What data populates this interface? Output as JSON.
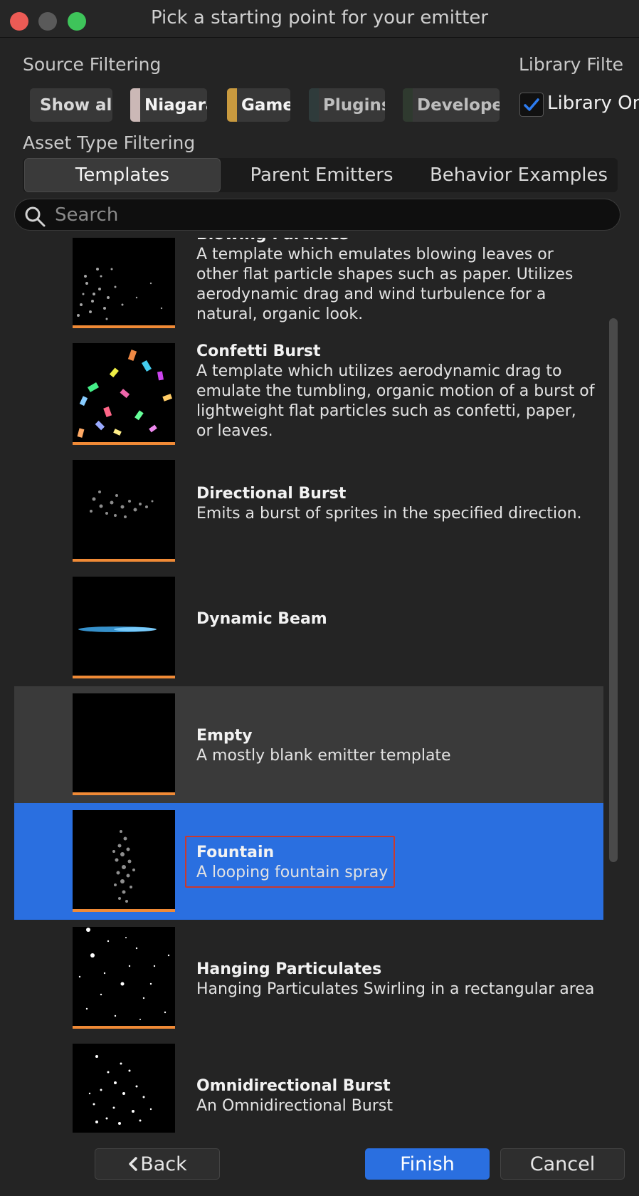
{
  "window": {
    "title": "Pick a starting point for your emitter"
  },
  "source_filtering": {
    "label": "Source Filtering",
    "buttons": [
      {
        "label": "Show all",
        "color": null
      },
      {
        "label": "Niagara",
        "color": "#cbb8b6"
      },
      {
        "label": "Game",
        "color": "#c99a3f"
      },
      {
        "label": "Plugins",
        "color": "#2f3b3b"
      },
      {
        "label": "Developer",
        "color": "#2f3a2f"
      }
    ]
  },
  "library_filtering": {
    "label": "Library Filte",
    "checkbox_label": "Library Onl",
    "checked": true
  },
  "asset_type_filtering": {
    "label": "Asset Type Filtering",
    "tabs": [
      "Templates",
      "Parent Emitters",
      "Behavior Examples"
    ],
    "active_tab": "Templates"
  },
  "search": {
    "placeholder": "Search",
    "value": ""
  },
  "items": [
    {
      "name": "Blowing Particles",
      "desc": "A template which emulates blowing leaves or other flat particle shapes such as paper. Utilizes aerodynamic drag and wind turbulence for a natural, organic look."
    },
    {
      "name": "Confetti Burst",
      "desc": "A template which utilizes aerodynamic drag to emulate the tumbling, organic motion of a burst of lightweight flat particles such as confetti, paper, or leaves."
    },
    {
      "name": "Directional Burst",
      "desc": "Emits a burst of sprites in the specified direction."
    },
    {
      "name": "Dynamic Beam",
      "desc": ""
    },
    {
      "name": "Empty",
      "desc": "A mostly blank emitter template",
      "state": "hover"
    },
    {
      "name": "Fountain",
      "desc": "A looping fountain spray",
      "state": "selected"
    },
    {
      "name": "Hanging Particulates",
      "desc": "Hanging Particulates Swirling in a rectangular area"
    },
    {
      "name": "Omnidirectional Burst",
      "desc": "An Omnidirectional Burst"
    }
  ],
  "footer": {
    "back": "Back",
    "finish": "Finish",
    "cancel": "Cancel"
  },
  "colors": {
    "accent": "#2a6fe0",
    "thumb_bar": "#f08a36",
    "selection_outline": "#c93a2e"
  }
}
